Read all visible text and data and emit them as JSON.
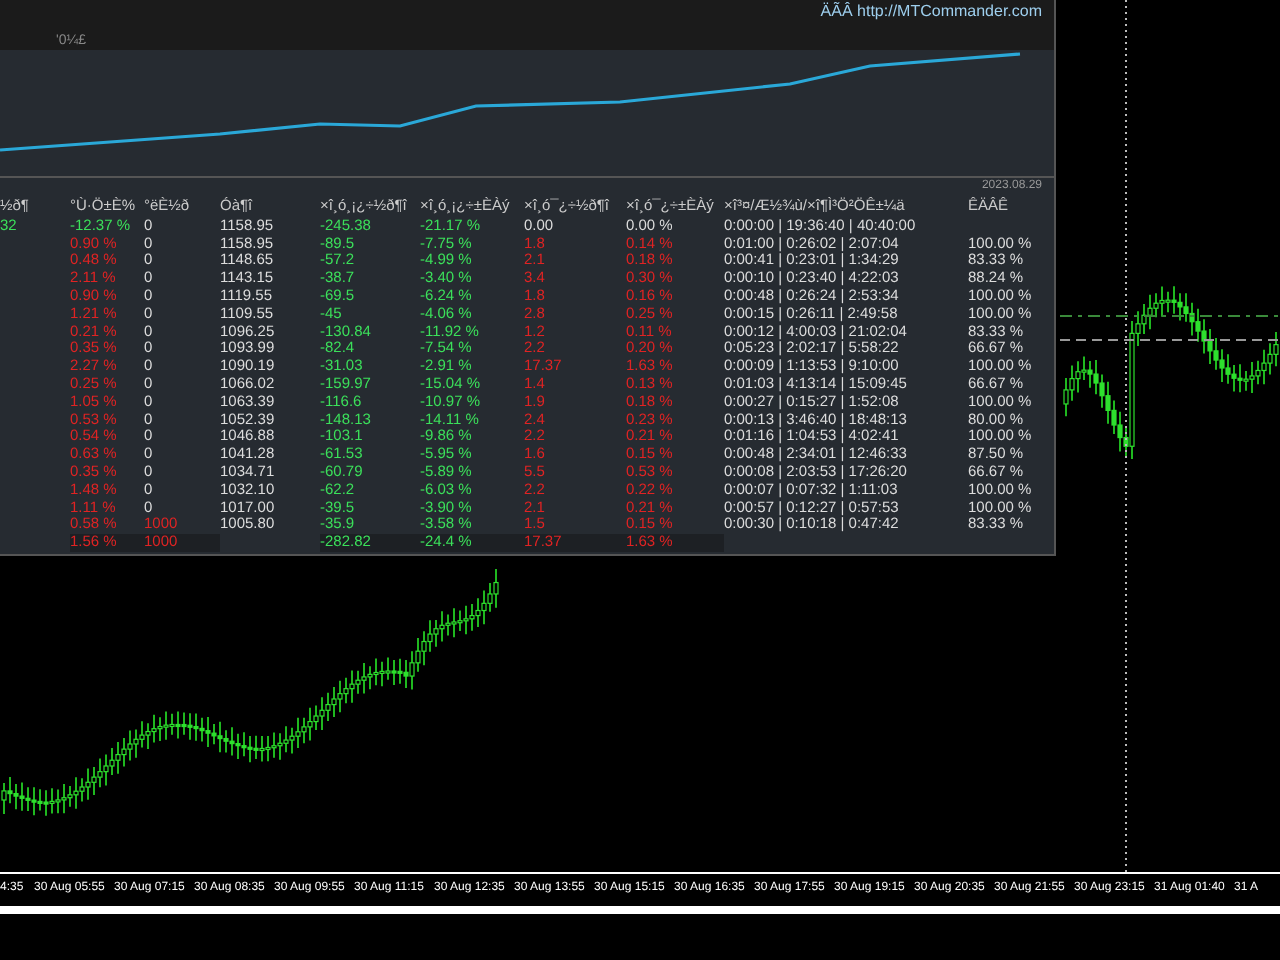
{
  "panel": {
    "link": "ÄÃÂ http://MTCommander.com",
    "equity_label": "'0¼£",
    "equity_date": "2023.08.29",
    "table": {
      "columns": [
        "½ð¶",
        "°Ù·Ö±È%",
        "°ëÈ½ð",
        "Óà¶î",
        "×î¸ó¸¡¿÷½ð¶î",
        "×î¸ó¸¡¿÷±ÈÀý",
        "×î¸ó¯¿÷½ð¶î",
        "×î¸ó¯¿÷±ÈÀý",
        "×î³¤/Æ½¾ù/×î¶Ì³Ö²ÖÊ±¼ä",
        "ÊÄÂÊ"
      ],
      "rows": [
        {
          "kind": "start",
          "deposit": false,
          "cells": [
            "32",
            "-12.37 %",
            "0",
            "1158.95",
            "-245.38",
            "-21.17 %",
            "0.00",
            "0.00 %",
            "0:00:00 | 19:36:40 | 40:40:00",
            null
          ]
        },
        {
          "kind": "period",
          "deposit": false,
          "cells": [
            null,
            "0.90 %",
            "0",
            "1158.95",
            "-89.5",
            "-7.75 %",
            "1.8",
            "0.14 %",
            "0:01:00 | 0:26:02 | 2:07:04",
            "100.00 %"
          ]
        },
        {
          "kind": "period",
          "deposit": false,
          "cells": [
            null,
            "0.48 %",
            "0",
            "1148.65",
            "-57.2",
            "-4.99 %",
            "2.1",
            "0.18 %",
            "0:00:41 | 0:23:01 | 1:34:29",
            "83.33 %"
          ]
        },
        {
          "kind": "period",
          "deposit": false,
          "cells": [
            null,
            "2.11 %",
            "0",
            "1143.15",
            "-38.7",
            "-3.40 %",
            "3.4",
            "0.30 %",
            "0:00:10 | 0:23:40 | 4:22:03",
            "88.24 %"
          ]
        },
        {
          "kind": "period",
          "deposit": false,
          "cells": [
            null,
            "0.90 %",
            "0",
            "1119.55",
            "-69.5",
            "-6.24 %",
            "1.8",
            "0.16 %",
            "0:00:48 | 0:26:24 | 2:53:34",
            "100.00 %"
          ]
        },
        {
          "kind": "period",
          "deposit": false,
          "cells": [
            null,
            "1.21 %",
            "0",
            "1109.55",
            "-45",
            "-4.06 %",
            "2.8",
            "0.25 %",
            "0:00:15 | 0:26:11 | 2:49:58",
            "100.00 %"
          ]
        },
        {
          "kind": "period",
          "deposit": false,
          "cells": [
            null,
            "0.21 %",
            "0",
            "1096.25",
            "-130.84",
            "-11.92 %",
            "1.2",
            "0.11 %",
            "0:00:12 | 4:00:03 | 21:02:04",
            "83.33 %"
          ]
        },
        {
          "kind": "period",
          "deposit": false,
          "cells": [
            null,
            "0.35 %",
            "0",
            "1093.99",
            "-82.4",
            "-7.54 %",
            "2.2",
            "0.20 %",
            "0:05:23 | 2:02:17 | 5:58:22",
            "66.67 %"
          ]
        },
        {
          "kind": "period",
          "deposit": false,
          "cells": [
            null,
            "2.27 %",
            "0",
            "1090.19",
            "-31.03",
            "-2.91 %",
            "17.37",
            "1.63 %",
            "0:00:09 | 1:13:53 | 9:10:00",
            "100.00 %"
          ]
        },
        {
          "kind": "period",
          "deposit": false,
          "cells": [
            null,
            "0.25 %",
            "0",
            "1066.02",
            "-159.97",
            "-15.04 %",
            "1.4",
            "0.13 %",
            "0:01:03 | 4:13:14 | 15:09:45",
            "66.67 %"
          ]
        },
        {
          "kind": "period",
          "deposit": false,
          "cells": [
            null,
            "1.05 %",
            "0",
            "1063.39",
            "-116.6",
            "-10.97 %",
            "1.9",
            "0.18 %",
            "0:00:27 | 0:15:27 | 1:52:08",
            "100.00 %"
          ]
        },
        {
          "kind": "period",
          "deposit": false,
          "cells": [
            null,
            "0.53 %",
            "0",
            "1052.39",
            "-148.13",
            "-14.11 %",
            "2.4",
            "0.23 %",
            "0:00:13 | 3:46:40 | 18:48:13",
            "80.00 %"
          ]
        },
        {
          "kind": "period",
          "deposit": false,
          "cells": [
            null,
            "0.54 %",
            "0",
            "1046.88",
            "-103.1",
            "-9.86 %",
            "2.2",
            "0.21 %",
            "0:01:16 | 1:04:53 | 4:02:41",
            "100.00 %"
          ]
        },
        {
          "kind": "period",
          "deposit": false,
          "cells": [
            null,
            "0.63 %",
            "0",
            "1041.28",
            "-61.53",
            "-5.95 %",
            "1.6",
            "0.15 %",
            "0:00:48 | 2:34:01 | 12:46:33",
            "87.50 %"
          ]
        },
        {
          "kind": "period",
          "deposit": false,
          "cells": [
            null,
            "0.35 %",
            "0",
            "1034.71",
            "-60.79",
            "-5.89 %",
            "5.5",
            "0.53 %",
            "0:00:08 | 2:03:53 | 17:26:20",
            "66.67 %"
          ]
        },
        {
          "kind": "period",
          "deposit": false,
          "cells": [
            null,
            "1.48 %",
            "0",
            "1032.10",
            "-62.2",
            "-6.03 %",
            "2.2",
            "0.22 %",
            "0:00:07 | 0:07:32 | 1:11:03",
            "100.00 %"
          ]
        },
        {
          "kind": "period",
          "deposit": false,
          "cells": [
            null,
            "1.11 %",
            "0",
            "1017.00",
            "-39.5",
            "-3.90 %",
            "2.1",
            "0.21 %",
            "0:00:57 | 0:12:27 | 0:57:53",
            "100.00 %"
          ]
        },
        {
          "kind": "period",
          "deposit": true,
          "cells": [
            null,
            "0.58 %",
            "1000",
            "1005.80",
            "-35.9",
            "-3.58 %",
            "1.5",
            "0.15 %",
            "0:00:30 | 0:10:18 | 0:47:42",
            "83.33 %"
          ]
        },
        {
          "kind": "total",
          "deposit": true,
          "cells": [
            null,
            "1.56 %",
            "1000",
            null,
            "-282.82",
            "-24.4 %",
            "17.37",
            "1.63 %",
            null,
            null
          ]
        }
      ]
    }
  },
  "x_axis": {
    "labels": [
      "4:35",
      "30 Aug 05:55",
      "30 Aug 07:15",
      "30 Aug 08:35",
      "30 Aug 09:55",
      "30 Aug 11:15",
      "30 Aug 12:35",
      "30 Aug 13:55",
      "30 Aug 15:15",
      "30 Aug 16:35",
      "30 Aug 17:55",
      "30 Aug 19:15",
      "30 Aug 20:35",
      "30 Aug 21:55",
      "30 Aug 23:15",
      "31 Aug 01:40",
      "31 A"
    ]
  }
}
